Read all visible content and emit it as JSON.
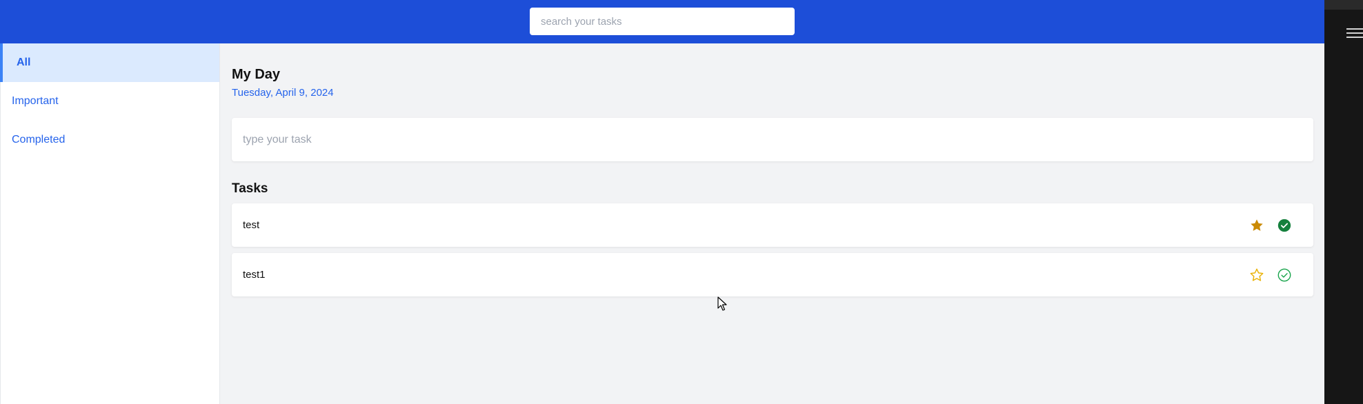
{
  "header": {
    "search_placeholder": "search your tasks"
  },
  "sidebar": {
    "items": [
      {
        "label": "All",
        "active": true
      },
      {
        "label": "Important",
        "active": false
      },
      {
        "label": "Completed",
        "active": false
      }
    ]
  },
  "main": {
    "title": "My Day",
    "date": "Tuesday, April 9, 2024",
    "task_input_placeholder": "type your task",
    "tasks_heading": "Tasks",
    "tasks": [
      {
        "text": "test",
        "important": true,
        "completed": true,
        "important_icon": "star-filled-icon",
        "complete_icon": "check-circle-filled-icon"
      },
      {
        "text": "test1",
        "important": false,
        "completed": false,
        "important_icon": "star-outline-icon",
        "complete_icon": "check-circle-outline-icon"
      }
    ]
  },
  "colors": {
    "header_bg": "#1d4ed8",
    "accent": "#2563eb",
    "active_nav_bg": "#dbeafe",
    "star_filled": "#ca8a04",
    "star_outline": "#eab308",
    "check_filled": "#15803d",
    "check_outline": "#16a34a"
  }
}
